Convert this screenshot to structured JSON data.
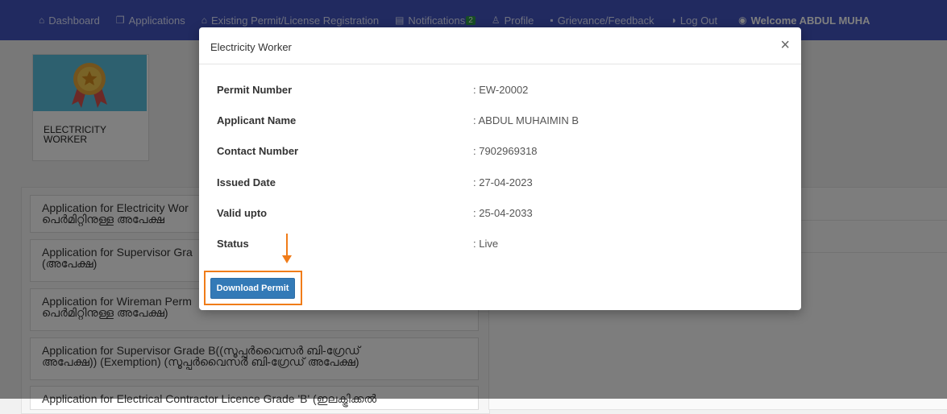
{
  "nav": {
    "items": [
      {
        "icon": "home-icon",
        "label": "Dashboard"
      },
      {
        "icon": "documents-icon",
        "label": "Applications"
      },
      {
        "icon": "registration-icon",
        "label": "Existing Permit/License Registration"
      },
      {
        "icon": "bell-icon",
        "label": "Notifications",
        "badge": "2"
      },
      {
        "icon": "user-icon",
        "label": "Profile"
      },
      {
        "icon": "file-icon",
        "label": "Grievance/Feedback"
      },
      {
        "icon": "power-icon",
        "label": "Log Out"
      }
    ],
    "welcome": "Welcome ABDUL MUHA",
    "colors": {
      "bar": "#4254c0",
      "badge": "#2e9b4a"
    }
  },
  "card": {
    "label_line1": "ELECTRICITY",
    "label_line2": "WORKER",
    "icon": "award-medal-icon"
  },
  "applications": [
    {
      "line1": "Application for Electricity Wor",
      "line2": "പെർമിറ്റിനുള്ള അപേക്ഷ"
    },
    {
      "line1": "Application for Supervisor Gra",
      "line2": "(അപേക്ഷ)"
    },
    {
      "line1": "Application for Wireman Perm",
      "line2": "പെർമിറ്റിനുള്ള അപേക്ഷ)"
    },
    {
      "line1": "Application for Supervisor Grade B((സൂപ്പർവൈസർ ബി-ഗ്രേഡ്",
      "line2": "അപേക്ഷ)) (Exemption) (സൂപ്പർവൈസർ ബി-ഗ്രേഡ് അപേക്ഷ)"
    },
    {
      "line1": "Application for Electrical Contractor Licence Grade 'B' (ഇലക്ട്രിക്കൽ",
      "line2": ""
    }
  ],
  "modal": {
    "title": "Electricity Worker",
    "close_symbol": "×",
    "fields": [
      {
        "label": "Permit Number",
        "value": ": EW-20002"
      },
      {
        "label": "Applicant Name",
        "value": ": ABDUL MUHAIMIN B"
      },
      {
        "label": "Contact Number",
        "value": ": 7902969318"
      },
      {
        "label": "Issued Date",
        "value": ": 27-04-2023"
      },
      {
        "label": "Valid upto",
        "value": ": 25-04-2033"
      },
      {
        "label": "Status",
        "value": ": Live"
      }
    ],
    "download_label": "Download Permit",
    "annotation_color": "#f07c19"
  }
}
